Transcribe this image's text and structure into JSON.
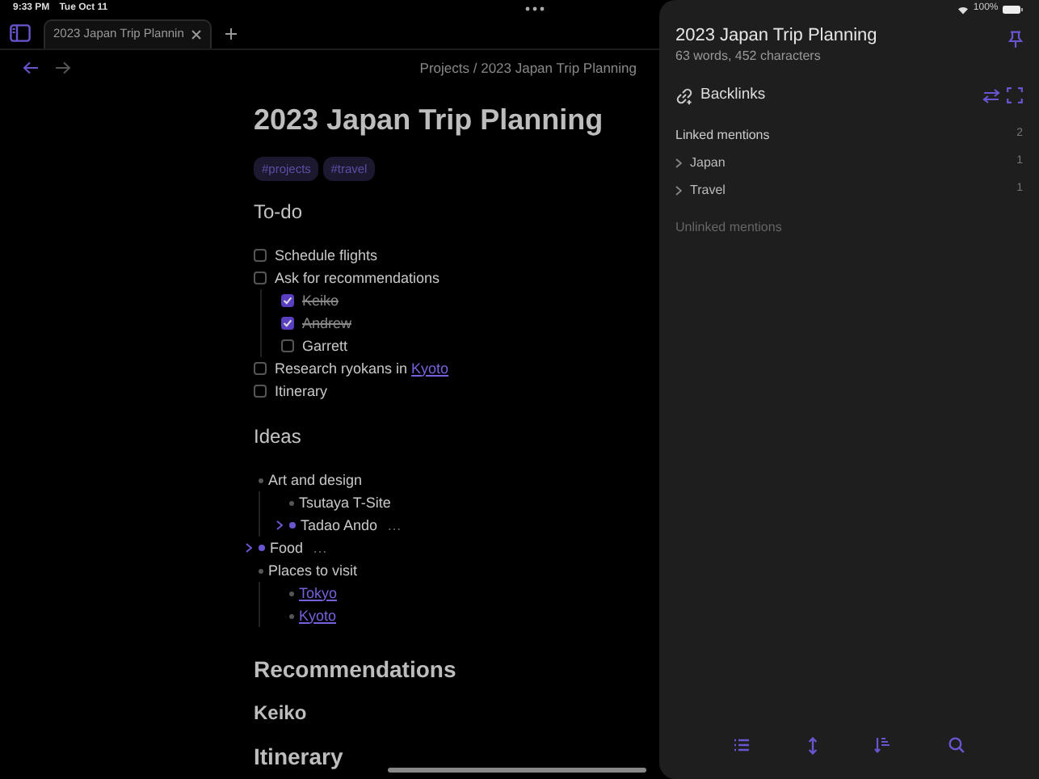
{
  "status_bar": {
    "time": "9:33 PM",
    "date": "Tue Oct 11",
    "battery": "100%"
  },
  "tab": {
    "title": "2023 Japan Trip Plannin",
    "selected": true
  },
  "breadcrumb": "Projects / 2023 Japan Trip Planning",
  "note": {
    "title": "2023 Japan Trip Planning",
    "tags": [
      "#projects",
      "#travel"
    ],
    "todo_heading": "To-do",
    "todos": [
      {
        "text": "Schedule flights",
        "checked": false
      },
      {
        "text": "Ask for recommendations",
        "checked": false,
        "children": [
          {
            "text": "Keiko",
            "checked": true
          },
          {
            "text": "Andrew",
            "checked": true
          },
          {
            "text": "Garrett",
            "checked": false
          }
        ]
      },
      {
        "text": "Research ryokans in ",
        "link": "Kyoto",
        "checked": false
      },
      {
        "text": "Itinerary",
        "checked": false
      }
    ],
    "ideas_heading": "Ideas",
    "ideas": [
      {
        "text": "Art and design",
        "collapsed": false,
        "children": [
          {
            "text": "Tsutaya T-Site",
            "collapsed": false
          },
          {
            "text": "Tadao Ando",
            "collapsed": true,
            "more": "…"
          }
        ]
      },
      {
        "text": "Food",
        "collapsed": true,
        "more": "…"
      },
      {
        "text": "Places to visit",
        "collapsed": false,
        "children": [
          {
            "link": "Tokyo",
            "collapsed": false
          },
          {
            "link": "Kyoto",
            "collapsed": false
          }
        ]
      }
    ],
    "sections": [
      {
        "kind": "h2",
        "text": "Recommendations"
      },
      {
        "kind": "h3",
        "text": "Keiko"
      },
      {
        "kind": "h2",
        "text": "Itinerary"
      }
    ]
  },
  "panel": {
    "title": "2023 Japan Trip Planning",
    "stats": "63 words, 452 characters",
    "header": "Backlinks",
    "linked": {
      "label": "Linked mentions",
      "count": "2"
    },
    "mentions": [
      {
        "name": "Japan",
        "count": "1"
      },
      {
        "name": "Travel",
        "count": "1"
      }
    ],
    "unlinked": "Unlinked mentions"
  }
}
